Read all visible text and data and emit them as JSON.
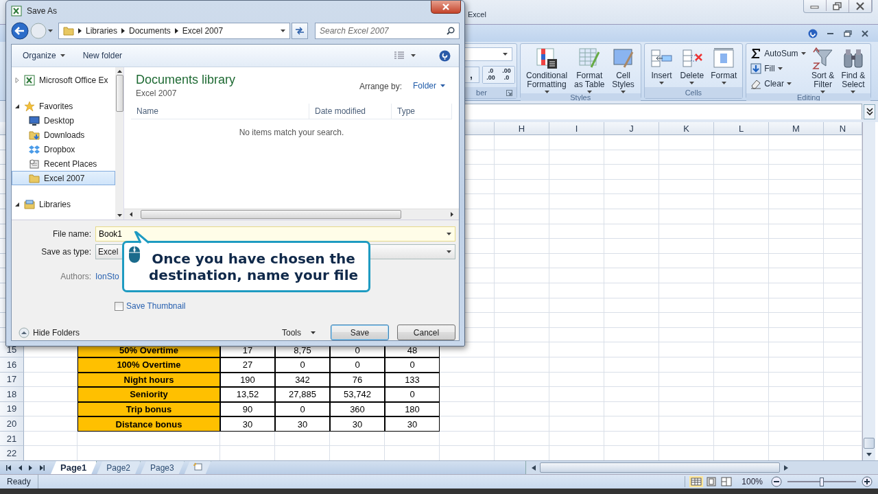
{
  "excel": {
    "title": "Excel",
    "ribbon": {
      "number_group": {
        "label": "ber",
        "comma": ",",
        "decimals": [
          {
            "top": ".0",
            "bottom": ".00"
          },
          {
            "top": ".00",
            "bottom": ".0"
          }
        ]
      },
      "groups": [
        {
          "label": "Styles",
          "buttons": [
            {
              "label": "Conditional\nFormatting",
              "kind": "conditional"
            },
            {
              "label": "Format\nas Table",
              "kind": "table"
            },
            {
              "label": "Cell\nStyles",
              "kind": "styles"
            }
          ]
        },
        {
          "label": "Cells",
          "buttons": [
            {
              "label": "Insert",
              "kind": "insert"
            },
            {
              "label": "Delete",
              "kind": "delete"
            },
            {
              "label": "Format",
              "kind": "format"
            }
          ]
        },
        {
          "label": "Editing",
          "small": [
            {
              "label": "AutoSum",
              "kind": "sum"
            },
            {
              "label": "Fill",
              "kind": "fill"
            },
            {
              "label": "Clear",
              "kind": "clear"
            }
          ],
          "buttons": [
            {
              "label": "Sort &\nFilter",
              "kind": "sort"
            },
            {
              "label": "Find &\nSelect",
              "kind": "find"
            }
          ]
        }
      ]
    },
    "columns": [
      "H",
      "I",
      "J",
      "K",
      "L",
      "M",
      "N"
    ],
    "rows": [
      {
        "number": "15",
        "cells": [
          "50% Overtime",
          "17",
          "8,75",
          "0",
          "48"
        ]
      },
      {
        "number": "16",
        "cells": [
          "100% Overtime",
          "27",
          "0",
          "0",
          "0"
        ]
      },
      {
        "number": "17",
        "cells": [
          "Night hours",
          "190",
          "342",
          "76",
          "133"
        ]
      },
      {
        "number": "18",
        "cells": [
          "Seniority",
          "13,52",
          "27,885",
          "53,742",
          "0"
        ]
      },
      {
        "number": "19",
        "cells": [
          "Trip bonus",
          "90",
          "0",
          "360",
          "180"
        ]
      },
      {
        "number": "20",
        "cells": [
          "Distance bonus",
          "30",
          "30",
          "30",
          "30"
        ]
      },
      {
        "number": "21",
        "cells": []
      },
      {
        "number": "22",
        "cells": []
      }
    ],
    "sheet_tabs": [
      {
        "label": "Page1",
        "selected": true
      },
      {
        "label": "Page2",
        "selected": false
      },
      {
        "label": "Page3",
        "selected": false
      }
    ],
    "status": "Ready",
    "zoom": {
      "reading": "100%",
      "level": 0.5
    }
  },
  "dialog": {
    "title": "Save As",
    "breadcrumb": [
      "Libraries",
      "Documents",
      "Excel 2007"
    ],
    "search": {
      "placeholder": "Search Excel 2007"
    },
    "toolbar": [
      {
        "label": "Organize",
        "menu": true
      },
      {
        "label": "New folder",
        "menu": false
      }
    ],
    "nav": [
      {
        "label": "Microsoft Office Ex",
        "kind": "excel",
        "expanded": false,
        "selected": false
      },
      {
        "label": "Favorites",
        "kind": "star",
        "expanded": true,
        "selected": false,
        "children": [
          {
            "label": "Desktop",
            "kind": "desktop",
            "selected": false
          },
          {
            "label": "Downloads",
            "kind": "downloads",
            "selected": false
          },
          {
            "label": "Dropbox",
            "kind": "dropbox",
            "selected": false
          },
          {
            "label": "Recent Places",
            "kind": "recent",
            "selected": false
          },
          {
            "label": "Excel 2007",
            "kind": "folder",
            "selected": true
          }
        ]
      },
      {
        "label": "Libraries",
        "kind": "library",
        "expanded": true,
        "selected": false
      }
    ],
    "library": {
      "title": "Documents library",
      "subtitle": "Excel 2007",
      "arrange_label": "Arrange by:",
      "arrange_value": "Folder"
    },
    "columns": [
      "Name",
      "Date modified",
      "Type"
    ],
    "empty_message": "No items match your search.",
    "file_name": {
      "label": "File name:",
      "value": "Book1"
    },
    "save_as_type": {
      "label": "Save as type:",
      "value": "Excel"
    },
    "authors": {
      "label": "Authors:",
      "value": "IonSto"
    },
    "save_thumbnail": {
      "label": "Save Thumbnail",
      "checked": false
    },
    "hide_folders": "Hide Folders",
    "tools": "Tools",
    "buttons": [
      {
        "label": "Save",
        "default": true
      },
      {
        "label": "Cancel",
        "default": false
      }
    ]
  },
  "callout": {
    "text": "Once you have chosen the\ndestination, name your file"
  }
}
